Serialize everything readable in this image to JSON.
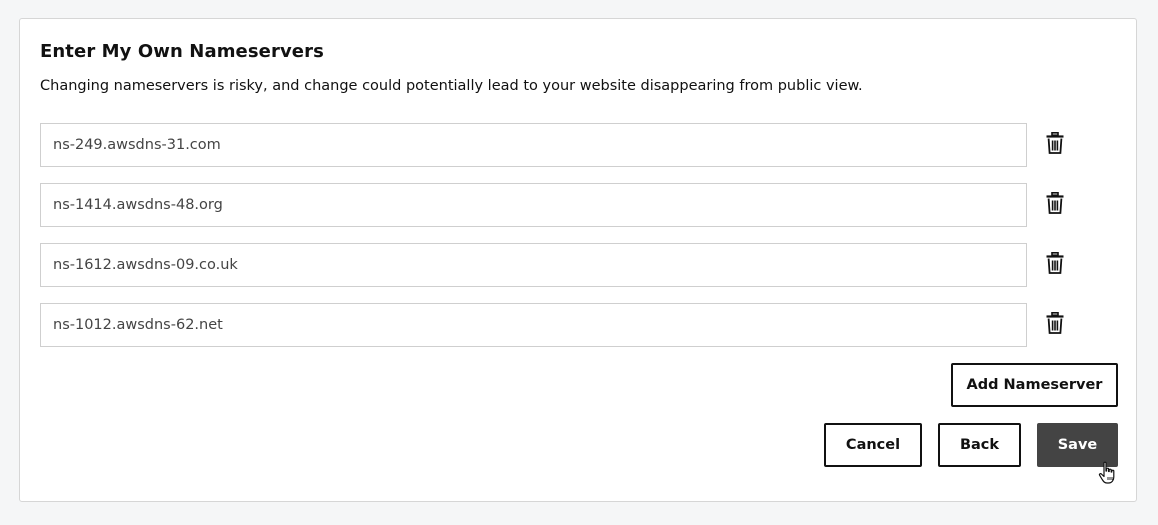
{
  "title": "Enter My Own Nameservers",
  "subtitle": "Changing nameservers is risky, and change could potentially lead to your website disappearing from public view.",
  "nameservers": [
    {
      "value": "ns-249.awsdns-31.com",
      "delete_icon": "trash-icon"
    },
    {
      "value": "ns-1414.awsdns-48.org",
      "delete_icon": "trash-icon"
    },
    {
      "value": "ns-1612.awsdns-09.co.uk",
      "delete_icon": "trash-icon"
    },
    {
      "value": "ns-1012.awsdns-62.net",
      "delete_icon": "trash-icon"
    }
  ],
  "buttons": {
    "add_nameserver": "Add Nameserver",
    "cancel": "Cancel",
    "back": "Back",
    "save": "Save"
  },
  "colors": {
    "primary_button_bg": "#444444",
    "page_bg": "#f5f6f7",
    "text": "#111111"
  },
  "cursor_icon": "hand-pointer-icon"
}
